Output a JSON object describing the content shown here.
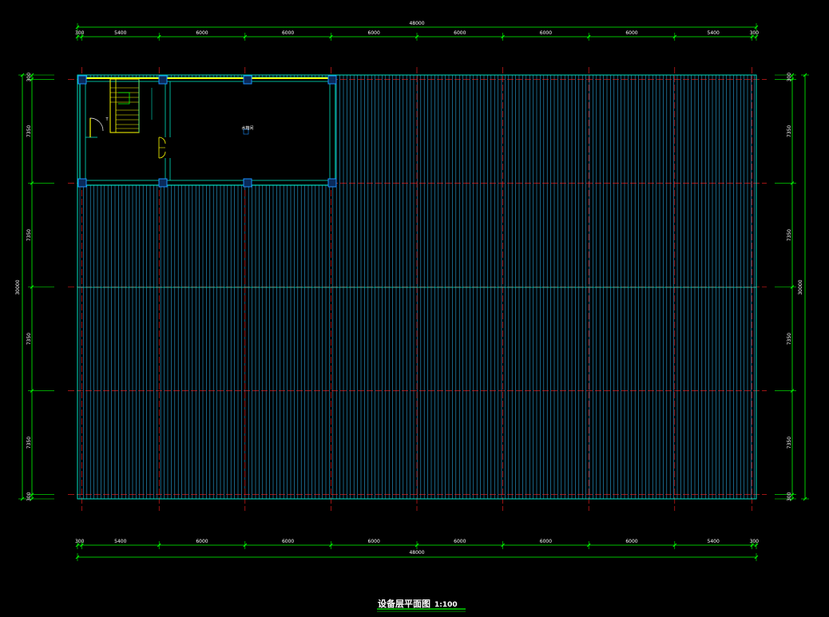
{
  "drawing": {
    "title": "设备层平面图",
    "scale": "1:100",
    "overall_width": "48000",
    "overall_depth": "30000",
    "room_label": "水箱间",
    "door_mark": "T",
    "colors": {
      "background": "#000000",
      "dimension": "#00ff00",
      "axis": "#ff2020",
      "roof_lines": "#2aa7e0",
      "walls": "#00e0c0",
      "stair": "#ffff00",
      "columns": "#1a8fff"
    },
    "horizontal_spans": [
      "300",
      "5400",
      "6000",
      "6000",
      "6000",
      "6000",
      "6000",
      "6000",
      "5400",
      "300"
    ],
    "vertical_spans_left": [
      "300",
      "7350",
      "7350",
      "7350",
      "7350",
      "300"
    ],
    "vertical_spans_right": [
      "300",
      "7350",
      "7350",
      "7350",
      "7350",
      "300"
    ]
  }
}
